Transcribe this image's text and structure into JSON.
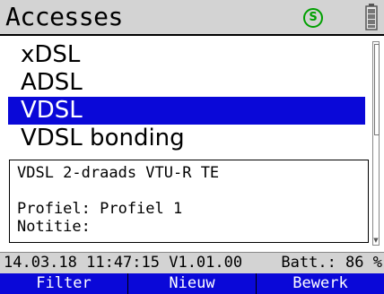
{
  "header": {
    "title": "Accesses",
    "service_icon_letter": "S",
    "service_icon": "service-status-icon",
    "battery_icon": "battery-icon"
  },
  "accesses": {
    "items": [
      {
        "label": "xDSL",
        "selected": false
      },
      {
        "label": "ADSL",
        "selected": false
      },
      {
        "label": "VDSL",
        "selected": true
      },
      {
        "label": "VDSL bonding",
        "selected": false
      }
    ]
  },
  "detail": {
    "line1": "VDSL 2-draads VTU-R TE",
    "line2": "",
    "line3": "Profiel: Profiel 1",
    "line4": "Notitie:"
  },
  "status": {
    "datetime_version": "14.03.18 11:47:15 V1.01.00",
    "battery": "Batt.: 86 %"
  },
  "softkeys": {
    "filter": "Filter",
    "new": "Nieuw",
    "edit": "Bewerk"
  },
  "colors": {
    "selection": "#0a08d8",
    "header_bg": "#d3d3d3",
    "service_icon": "#00a000"
  }
}
